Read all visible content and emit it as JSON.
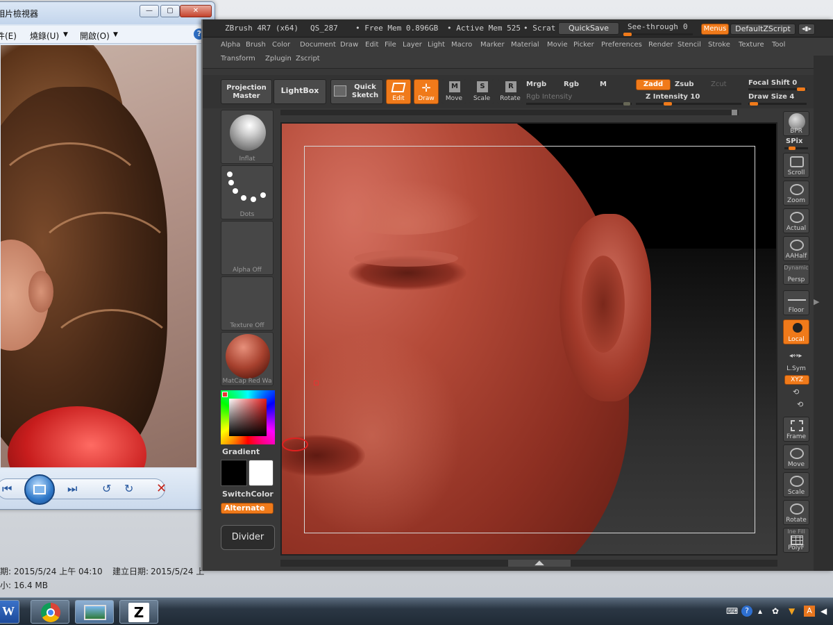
{
  "viewer": {
    "title": "相片檢視器",
    "menu": [
      "件(E)",
      "燒錄(U)",
      "開啟(O)"
    ],
    "help": "?"
  },
  "details": {
    "taken": "期: 2015/5/24 上午 04:10",
    "created_label": "建立日期:",
    "created_value": "2015/5/24 上",
    "size": "小: 16.4 MB"
  },
  "zbrush": {
    "title": "ZBrush 4R7 (x64)",
    "project": "QS_287",
    "free_mem": "• Free Mem 0.896GB",
    "active_mem": "• Active Mem 525",
    "scrat": "• Scrat",
    "quicksave": "QuickSave",
    "see_through": "See-through",
    "see_through_value": "0",
    "menus": "Menus",
    "script": "DefaultZScript",
    "menu_items": [
      "Alpha",
      "Brush",
      "Color",
      "Document",
      "Draw",
      "Edit",
      "File",
      "Layer",
      "Light",
      "Macro",
      "Marker",
      "Material",
      "Movie",
      "Picker",
      "Preferences",
      "Render",
      "Stencil",
      "Stroke",
      "Texture",
      "Tool",
      "Transform",
      "Zplugin",
      "Zscript"
    ],
    "shelf": {
      "projection_master": "Projection Master",
      "lightbox": "LightBox",
      "quick_sketch": "Quick Sketch",
      "edit": "Edit",
      "draw": "Draw",
      "move": "Move",
      "scale": "Scale",
      "rotate": "Rotate",
      "mrgb": "Mrgb",
      "rgb": "Rgb",
      "m": "M",
      "rgb_intensity": "Rgb Intensity",
      "zadd": "Zadd",
      "zsub": "Zsub",
      "zcut": "Zcut",
      "z_intensity": "Z Intensity 10",
      "focal_shift": "Focal Shift 0",
      "draw_size": "Draw Size 4"
    },
    "left": {
      "brush": "Inflat",
      "stroke": "Dots",
      "alpha": "Alpha Off",
      "texture": "Texture Off",
      "material": "MatCap Red Wa",
      "gradient": "Gradient",
      "switch_color": "SwitchColor",
      "alternate": "Alternate",
      "divider": "Divider"
    },
    "right": [
      "BPR",
      "SPix",
      "Scroll",
      "Zoom",
      "Actual",
      "AAHalf",
      "Dynamic",
      "Persp",
      "Floor",
      "Local",
      "L.Sym",
      "XYZ",
      "Frame",
      "Move",
      "Scale",
      "Rotate",
      "Ine Fill",
      "PolyF"
    ]
  },
  "taskbar": {
    "word": "W",
    "tray_time": ""
  }
}
